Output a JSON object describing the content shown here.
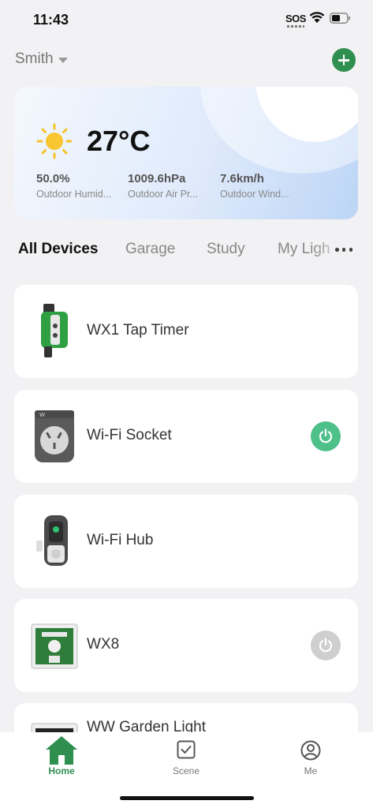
{
  "status_bar": {
    "time": "11:43",
    "sos": "SOS"
  },
  "header": {
    "home_name": "Smith"
  },
  "weather": {
    "temperature": "27°C",
    "metrics": [
      {
        "value": "50.0%",
        "label": "Outdoor Humid..."
      },
      {
        "value": "1009.6hPa",
        "label": "Outdoor Air Pr..."
      },
      {
        "value": "7.6km/h",
        "label": "Outdoor Wind..."
      }
    ]
  },
  "tabs": [
    "All Devices",
    "Garage",
    "Study",
    "My Ligh"
  ],
  "devices": [
    {
      "name": "WX1 Tap Timer",
      "power": null
    },
    {
      "name": "Wi-Fi Socket",
      "power": "on"
    },
    {
      "name": "Wi-Fi Hub",
      "power": null
    },
    {
      "name": "WX8",
      "power": "off"
    },
    {
      "name": "WW Garden Light",
      "power": null
    }
  ],
  "nav": {
    "home": "Home",
    "scene": "Scene",
    "me": "Me"
  },
  "colors": {
    "accent": "#2f8f4e",
    "power_on": "#4ec08a",
    "power_off": "#cfcfcf"
  }
}
